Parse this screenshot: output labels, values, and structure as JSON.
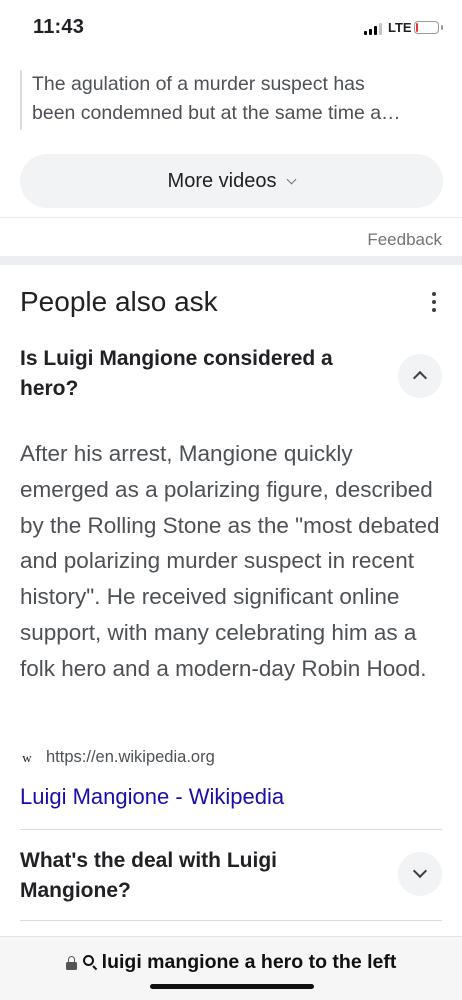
{
  "status_bar": {
    "time": "11:43",
    "network": "LTE",
    "signal_bars_filled": 3,
    "signal_bars_total": 4,
    "battery_level_fraction": 0.1,
    "battery_color": "#e53935"
  },
  "video_snippet": {
    "line1": "The agulation of a murder suspect has",
    "line2": "been condemned but at the same time a…"
  },
  "more_videos": {
    "label": "More videos"
  },
  "feedback": {
    "label": "Feedback"
  },
  "people_also_ask": {
    "title": "People also ask",
    "questions": [
      {
        "question": "Is Luigi Mangione considered a hero?",
        "expanded": true,
        "answer": "After his arrest, Mangione quickly emerged as a polarizing figure, described by the Rolling Stone as the \"most debated and polarizing murder suspect in recent history\". He received significant online support, with many celebrating him as a folk hero and a modern-day Robin Hood.",
        "source_icon": "w",
        "source_url": "https://en.wikipedia.org",
        "source_title": "Luigi Mangione - Wikipedia"
      },
      {
        "question": "What's the deal with Luigi Mangione?",
        "expanded": false
      }
    ]
  },
  "url_bar": {
    "query": "luigi mangione a hero to the left"
  },
  "colors": {
    "link": "#1a0dab",
    "text_primary": "#202124",
    "text_secondary": "#4d5156",
    "chip_bg": "#f1f3f4"
  }
}
